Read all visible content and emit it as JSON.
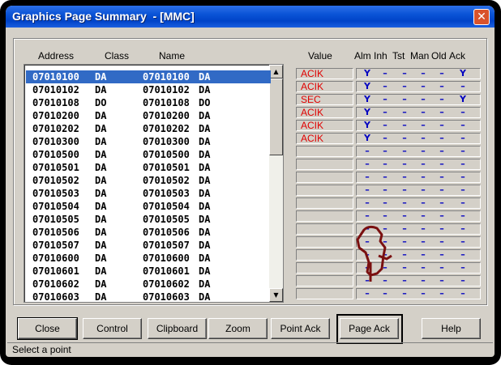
{
  "window": {
    "title": "Graphics Page Summary  - [MMC]"
  },
  "columns": {
    "address": "Address",
    "class": "Class",
    "name": "Name",
    "value": "Value",
    "flags": [
      "Alm",
      "Inh",
      "Tst",
      "Man",
      "Old",
      "Ack"
    ]
  },
  "rows": [
    {
      "address": "07010100",
      "class": "DA",
      "name": "07010100",
      "nclass": "DA",
      "value": "ACIK",
      "flags": [
        "Y",
        "–",
        "–",
        "–",
        "–",
        "Y"
      ],
      "selected": true
    },
    {
      "address": "07010102",
      "class": "DA",
      "name": "07010102",
      "nclass": "DA",
      "value": "ACIK",
      "flags": [
        "Y",
        "–",
        "–",
        "–",
        "–",
        "–"
      ]
    },
    {
      "address": "07010108",
      "class": "DO",
      "name": "07010108",
      "nclass": "DO",
      "value": "SEC",
      "flags": [
        "Y",
        "–",
        "–",
        "–",
        "–",
        "Y"
      ]
    },
    {
      "address": "07010200",
      "class": "DA",
      "name": "07010200",
      "nclass": "DA",
      "value": "ACIK",
      "flags": [
        "Y",
        "–",
        "–",
        "–",
        "–",
        "–"
      ]
    },
    {
      "address": "07010202",
      "class": "DA",
      "name": "07010202",
      "nclass": "DA",
      "value": "ACIK",
      "flags": [
        "Y",
        "–",
        "–",
        "–",
        "–",
        "–"
      ]
    },
    {
      "address": "07010300",
      "class": "DA",
      "name": "07010300",
      "nclass": "DA",
      "value": "ACIK",
      "flags": [
        "Y",
        "–",
        "–",
        "–",
        "–",
        "–"
      ]
    },
    {
      "address": "07010500",
      "class": "DA",
      "name": "07010500",
      "nclass": "DA",
      "value": "",
      "flags": [
        "–",
        "–",
        "–",
        "–",
        "–",
        "–"
      ]
    },
    {
      "address": "07010501",
      "class": "DA",
      "name": "07010501",
      "nclass": "DA",
      "value": "",
      "flags": [
        "–",
        "–",
        "–",
        "–",
        "–",
        "–"
      ]
    },
    {
      "address": "07010502",
      "class": "DA",
      "name": "07010502",
      "nclass": "DA",
      "value": "",
      "flags": [
        "–",
        "–",
        "–",
        "–",
        "–",
        "–"
      ]
    },
    {
      "address": "07010503",
      "class": "DA",
      "name": "07010503",
      "nclass": "DA",
      "value": "",
      "flags": [
        "–",
        "–",
        "–",
        "–",
        "–",
        "–"
      ]
    },
    {
      "address": "07010504",
      "class": "DA",
      "name": "07010504",
      "nclass": "DA",
      "value": "",
      "flags": [
        "–",
        "–",
        "–",
        "–",
        "–",
        "–"
      ]
    },
    {
      "address": "07010505",
      "class": "DA",
      "name": "07010505",
      "nclass": "DA",
      "value": "",
      "flags": [
        "–",
        "–",
        "–",
        "–",
        "–",
        "–"
      ]
    },
    {
      "address": "07010506",
      "class": "DA",
      "name": "07010506",
      "nclass": "DA",
      "value": "",
      "flags": [
        "–",
        "–",
        "–",
        "–",
        "–",
        "–"
      ]
    },
    {
      "address": "07010507",
      "class": "DA",
      "name": "07010507",
      "nclass": "DA",
      "value": "",
      "flags": [
        "–",
        "–",
        "–",
        "–",
        "–",
        "–"
      ]
    },
    {
      "address": "07010600",
      "class": "DA",
      "name": "07010600",
      "nclass": "DA",
      "value": "",
      "flags": [
        "–",
        "–",
        "–",
        "–",
        "–",
        "–"
      ]
    },
    {
      "address": "07010601",
      "class": "DA",
      "name": "07010601",
      "nclass": "DA",
      "value": "",
      "flags": [
        "–",
        "–",
        "–",
        "–",
        "–",
        "–"
      ]
    },
    {
      "address": "07010602",
      "class": "DA",
      "name": "07010602",
      "nclass": "DA",
      "value": "",
      "flags": [
        "–",
        "–",
        "–",
        "–",
        "–",
        "–"
      ]
    },
    {
      "address": "07010603",
      "class": "DA",
      "name": "07010603",
      "nclass": "DA",
      "value": "",
      "flags": [
        "–",
        "–",
        "–",
        "–",
        "–",
        "–"
      ]
    }
  ],
  "buttons": {
    "close": "Close",
    "control": "Control",
    "clipboard": "Clipboard",
    "zoom": "Zoom",
    "point_ack": "Point Ack",
    "page_ack": "Page Ack",
    "help": "Help"
  },
  "status": "Select a point",
  "icons": {
    "close": "close-icon",
    "scroll_up": "arrow-up-icon",
    "scroll_down": "arrow-down-icon",
    "pointer": "hand-pointer-icon"
  },
  "colors": {
    "title_bar": "#0a53d6",
    "selection": "#316ac5",
    "value_text": "#e00000",
    "flag_text": "#0000c0"
  }
}
